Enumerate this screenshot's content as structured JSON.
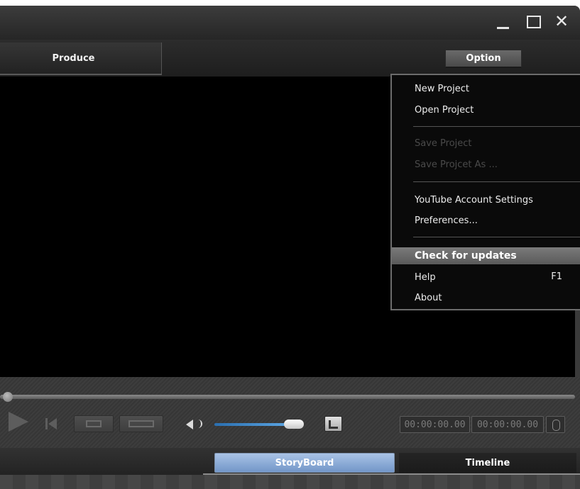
{
  "header": {
    "produce_tab": "Produce",
    "option_button": "Option"
  },
  "window_controls": {
    "close_glyph": "✕"
  },
  "option_menu": {
    "items": [
      {
        "label": "New Project",
        "enabled": true
      },
      {
        "label": "Open Project",
        "enabled": true
      },
      {
        "label": "Save Project",
        "enabled": false
      },
      {
        "label": "Save Projcet As ...",
        "enabled": false
      },
      {
        "label": "YouTube Account Settings",
        "enabled": true
      },
      {
        "label": "Preferences...",
        "enabled": true
      },
      {
        "label": "Check for updates",
        "enabled": true,
        "highlighted": true
      },
      {
        "label": "Help",
        "enabled": true,
        "shortcut": "F1"
      },
      {
        "label": "About",
        "enabled": true
      }
    ]
  },
  "player": {
    "timecode_current": "00:00:00.00",
    "timecode_duration": "00:00:00.00",
    "seek_position": 0,
    "volume_level": 0.88
  },
  "view_tabs": {
    "storyboard": "StoryBoard",
    "timeline": "Timeline",
    "active": "storyboard"
  },
  "colors": {
    "storyboard_tab": "#8aa9d6",
    "volume_fill": "#3d8ad0",
    "menu_highlight": "#6a6a6a"
  },
  "icons": [
    "minimize-icon",
    "maximize-icon",
    "close-icon",
    "play-icon",
    "skip-back-icon",
    "film-strip-icon",
    "speaker-icon",
    "fullscreen-icon",
    "spinner-icon"
  ]
}
